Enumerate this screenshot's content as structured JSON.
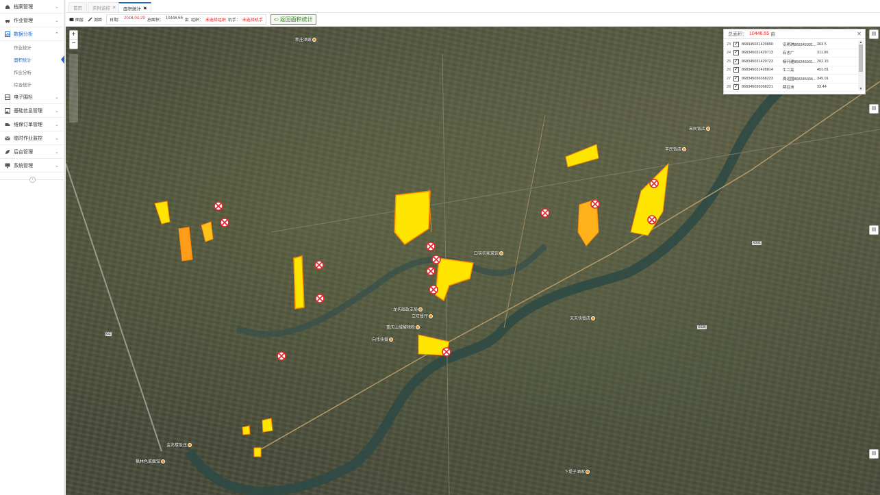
{
  "sidebar": {
    "items": [
      {
        "label": "档案管理",
        "icon": "home-icon"
      },
      {
        "label": "作业管理",
        "icon": "car-icon"
      },
      {
        "label": "数据分析",
        "icon": "chart-icon",
        "active": true
      },
      {
        "label": "电子围栏",
        "icon": "fence-icon"
      },
      {
        "label": "基础信息管理",
        "icon": "image-icon"
      },
      {
        "label": "维保订单管理",
        "icon": "truck-icon"
      },
      {
        "label": "临时作业监控",
        "icon": "mail-icon"
      },
      {
        "label": "后台管理",
        "icon": "leaf-icon"
      },
      {
        "label": "系统管理",
        "icon": "monitor-icon"
      }
    ],
    "subitems": [
      "作业统计",
      "面积统计",
      "作业分析",
      "综合统计"
    ],
    "selected_sub": "面积统计"
  },
  "tabs": [
    {
      "label": "首页"
    },
    {
      "label": "实时监控"
    },
    {
      "label": "面积统计"
    }
  ],
  "toolbar": {
    "layer_label": "图层",
    "measure_label": "测距",
    "date_label": "日期：",
    "date_value": "2018-04-29",
    "total_label": "总面积：",
    "total_value": "10446.55",
    "unit": "亩",
    "org_label": "组织：",
    "org_value": "未选择组织",
    "operator_label": "机手：",
    "operator_value": "未选择机手",
    "back_label": "返回面积统计"
  },
  "panel": {
    "title_label": "总面积：",
    "title_value": "10446.55",
    "title_unit": "亩",
    "rows": [
      {
        "n": "23",
        "id": "868345031429890",
        "name": "安明琪868345031429890",
        "area": "303.5"
      },
      {
        "n": "24",
        "id": "868345031429713",
        "name": "石志广",
        "area": "311.06"
      },
      {
        "n": "25",
        "id": "868345031429723",
        "name": "杨开建868345031429723",
        "area": "202.15"
      },
      {
        "n": "26",
        "id": "868345031428814",
        "name": "牛二亮",
        "area": "451.81"
      },
      {
        "n": "27",
        "id": "868345036368223",
        "name": "周运国868345036368223",
        "area": "345.91"
      },
      {
        "n": "28",
        "id": "868345036368221",
        "name": "薛召洲",
        "area": "33.44"
      }
    ]
  },
  "map": {
    "places": [
      {
        "label": "口袜农家菜馆",
        "id": "place-koumo"
      },
      {
        "label": "宋民饭店",
        "id": "place-songmin"
      },
      {
        "label": "丰民饭店",
        "id": "place-fengmin"
      },
      {
        "label": "立旺餐厅",
        "id": "place-liwang"
      },
      {
        "label": "重庆山城酸辣粉",
        "id": "place-chongqing"
      },
      {
        "label": "向伟快餐",
        "id": "place-xiangwei"
      },
      {
        "label": "天天快餐店",
        "id": "place-tiantian"
      },
      {
        "label": "金兆楼饭庄",
        "id": "place-jinzhao"
      },
      {
        "label": "枫林色菜面馆",
        "id": "place-fenglin"
      },
      {
        "label": "下堤子酒家",
        "id": "place-xiadi"
      },
      {
        "label": "新庄酒家",
        "id": "place-xinzhuang"
      },
      {
        "label": "龙坊邮政支局",
        "id": "place-longfang"
      }
    ],
    "road_labels": [
      "X002",
      "X036",
      "G2"
    ]
  },
  "colors": {
    "accent": "#1e66c8",
    "field_yellow": "#ffe600",
    "field_orange": "#ff8a00",
    "alert_red": "#e2262a"
  }
}
